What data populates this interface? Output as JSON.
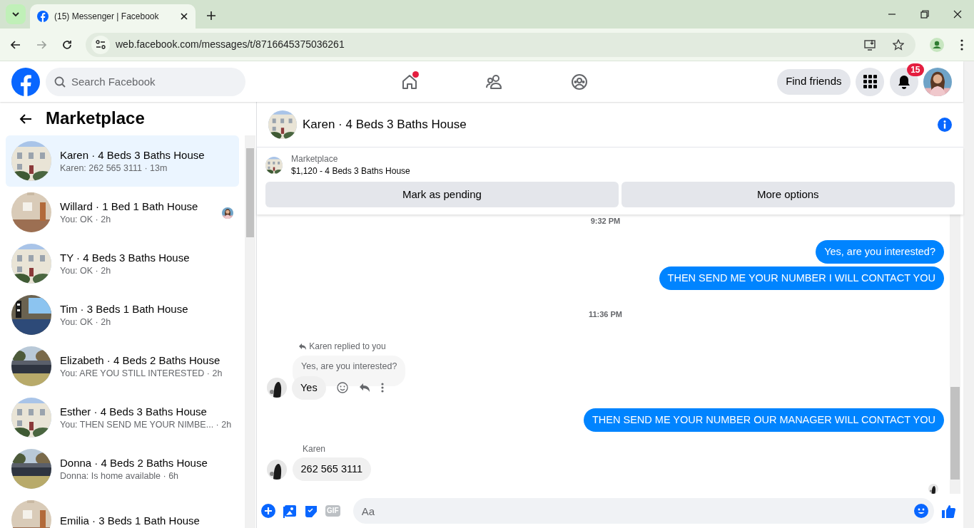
{
  "browser": {
    "tab": {
      "title": "(15) Messenger | Facebook",
      "selected": true
    },
    "url": "web.facebook.com/messages/t/8716645375036261"
  },
  "topbar": {
    "search": {
      "placeholder": "Search Facebook"
    },
    "nav": [
      {
        "kind": "home",
        "dot": true
      },
      {
        "kind": "friends",
        "dot": false
      },
      {
        "kind": "groups",
        "dot": false
      }
    ],
    "find_friends": "Find friends",
    "notifications": "15"
  },
  "sidebar": {
    "title": "Marketplace",
    "items": [
      {
        "title": "Karen · 4 Beds 3 Baths House",
        "preview": "Karen: 262 565 3111 · 13m",
        "selected": true,
        "seen": false
      },
      {
        "title": "Willard · 1 Bed 1 Bath House",
        "preview": "You: OK · 2h",
        "selected": false,
        "seen": true
      },
      {
        "title": "TY · 4 Beds 3 Baths House",
        "preview": "You: OK · 2h",
        "selected": false,
        "seen": false
      },
      {
        "title": "Tim · 3 Beds 1 Bath House",
        "preview": "You: OK · 2h",
        "selected": false,
        "seen": false
      },
      {
        "title": "Elizabeth · 4 Beds 2 Baths House",
        "preview": "You: ARE YOU STILL INTERESTED · 2h",
        "selected": false,
        "seen": false
      },
      {
        "title": "Esther · 4 Beds 3 Baths House",
        "preview": "You: THEN SEND ME YOUR NIMBE...  · 2h",
        "selected": false,
        "seen": false
      },
      {
        "title": "Donna · 4 Beds 2 Baths House",
        "preview": "Donna: Is home available · 6h",
        "selected": false,
        "seen": false
      },
      {
        "title": "Emilia · 3 Beds 1 Bath House",
        "selected": false,
        "seen": false
      }
    ]
  },
  "chat": {
    "title": "Karen · 4 Beds 3 Baths House",
    "listing": {
      "label": "Marketplace",
      "text": "$1,120 - 4 Beds 3 Baths House"
    },
    "buttons": [
      "Mark as pending",
      "More options"
    ],
    "messages": [
      {
        "kind": "time",
        "text": "9:32 PM"
      },
      {
        "kind": "outgoing",
        "text": "Yes, are you interested?"
      },
      {
        "kind": "outgoing",
        "text": "THEN SEND ME YOUR NUMBER I WILL CONTACT YOU"
      },
      {
        "kind": "time",
        "text": "11:36 PM"
      },
      {
        "kind": "reply",
        "label": "Karen replied to you",
        "quote": "Yes, are you interested?",
        "text": "Yes"
      },
      {
        "kind": "outgoing",
        "text": "THEN SEND ME YOUR NUMBER OUR MANAGER WILL CONTACT YOU"
      },
      {
        "kind": "incoming",
        "sender": "Karen",
        "text": "262 565 3111"
      },
      {
        "kind": "seen"
      }
    ],
    "composer": {
      "gif": "GIF",
      "placeholder": "Aa"
    }
  }
}
